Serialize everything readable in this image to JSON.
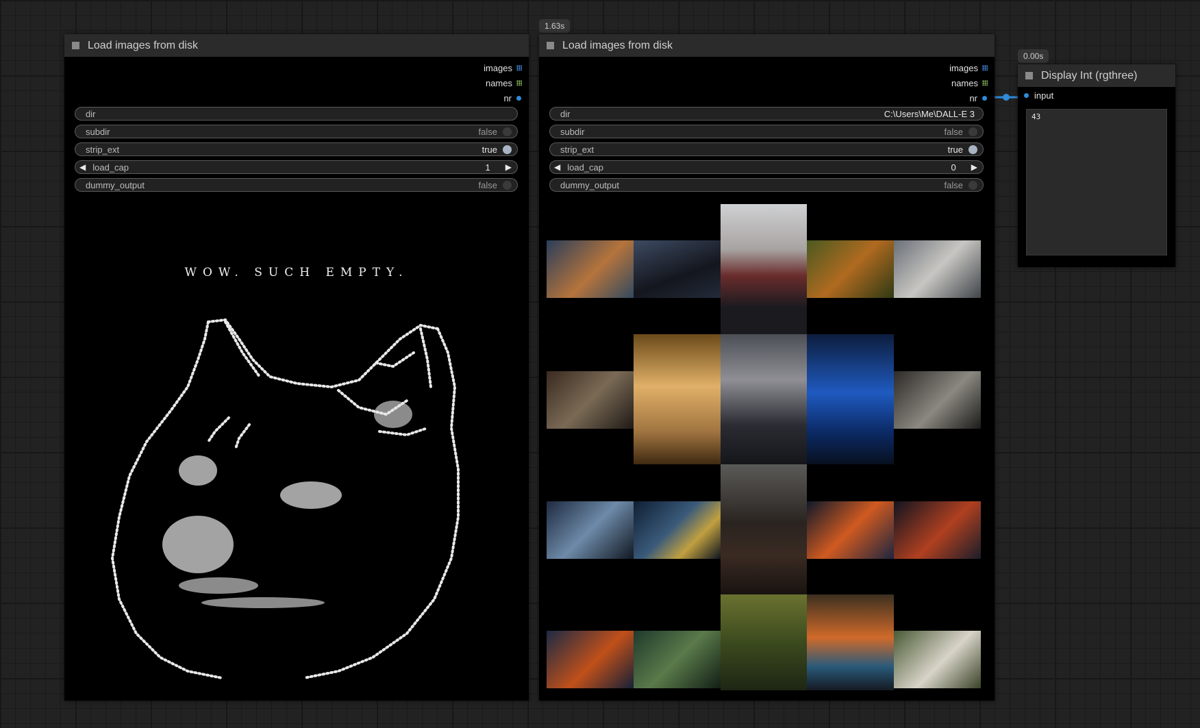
{
  "node_left": {
    "title": "Load images from disk",
    "outputs": [
      {
        "label": "images",
        "icon": "image-grid-icon"
      },
      {
        "label": "names",
        "icon": "string-grid-icon"
      },
      {
        "label": "nr",
        "icon": "int-dot-icon"
      }
    ],
    "widgets": {
      "dir": {
        "name": "dir",
        "value": ""
      },
      "subdir": {
        "name": "subdir",
        "value": "false"
      },
      "strip_ext": {
        "name": "strip_ext",
        "value": "true"
      },
      "load_cap": {
        "name": "load_cap",
        "value": "1"
      },
      "dummy_output": {
        "name": "dummy_output",
        "value": "false"
      }
    },
    "empty_message": "WOW. SUCH EMPTY."
  },
  "node_middle": {
    "timing": "1.63s",
    "title": "Load images from disk",
    "outputs": [
      {
        "label": "images",
        "icon": "image-grid-icon"
      },
      {
        "label": "names",
        "icon": "string-grid-icon"
      },
      {
        "label": "nr",
        "icon": "int-dot-icon"
      }
    ],
    "widgets": {
      "dir": {
        "name": "dir",
        "value": "C:\\Users\\Me\\DALL-E 3"
      },
      "subdir": {
        "name": "subdir",
        "value": "false"
      },
      "strip_ext": {
        "name": "strip_ext",
        "value": "true"
      },
      "load_cap": {
        "name": "load_cap",
        "value": "0"
      },
      "dummy_output": {
        "name": "dummy_output",
        "value": "false"
      }
    },
    "image_count_thumbnails": 22
  },
  "node_right": {
    "timing": "0.00s",
    "title": "Display Int (rgthree)",
    "input_label": "input",
    "display_value": "43"
  },
  "colors": {
    "canvas_bg": "#222222",
    "node_body": "#000000",
    "node_header": "#2b2b2b",
    "link_blue": "#2f8bd8",
    "image_socket": "#4b9eff",
    "string_socket": "#9ed36a"
  }
}
